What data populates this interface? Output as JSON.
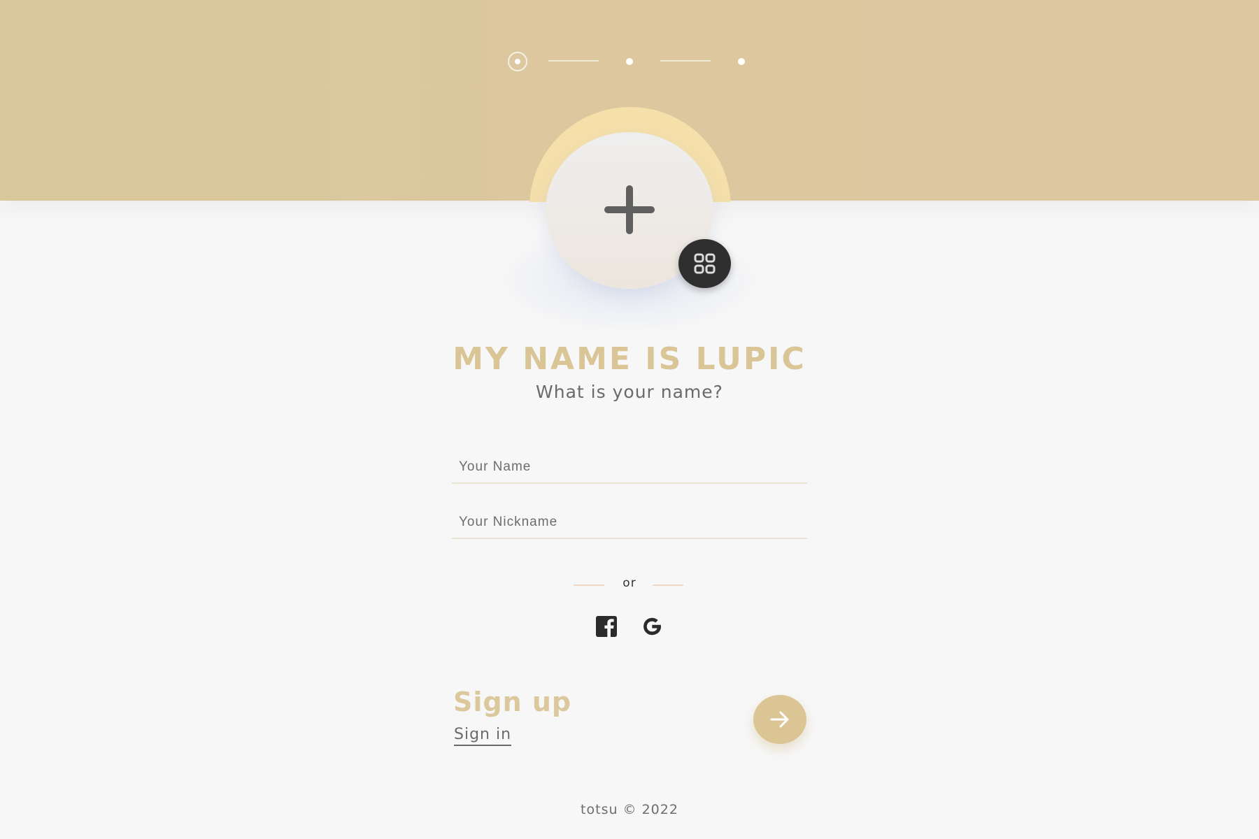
{
  "colors": {
    "header_band": "#dac79c",
    "accent_gold": "#d9c595",
    "avatar_halo": "#f7e0a7",
    "dark_button": "#2f2f2f",
    "background": "#f7f7f7"
  },
  "progress": {
    "steps": 3,
    "current_step": 1
  },
  "avatar": {
    "add_icon": "plus-icon",
    "menu_icon": "grid-icon"
  },
  "heading": {
    "title": "MY NAME IS LUPIC",
    "subtitle": "What is your name?"
  },
  "form": {
    "name_placeholder": "Your Name",
    "name_value": "",
    "nickname_placeholder": "Your Nickname",
    "nickname_value": ""
  },
  "divider": {
    "text": "or"
  },
  "social": {
    "facebook_icon": "facebook-icon",
    "google_icon": "google-icon"
  },
  "actions": {
    "signup_label": "Sign up",
    "signin_label": "Sign in",
    "next_icon": "arrow-right-icon"
  },
  "footer": {
    "text": "totsu © 2022"
  }
}
